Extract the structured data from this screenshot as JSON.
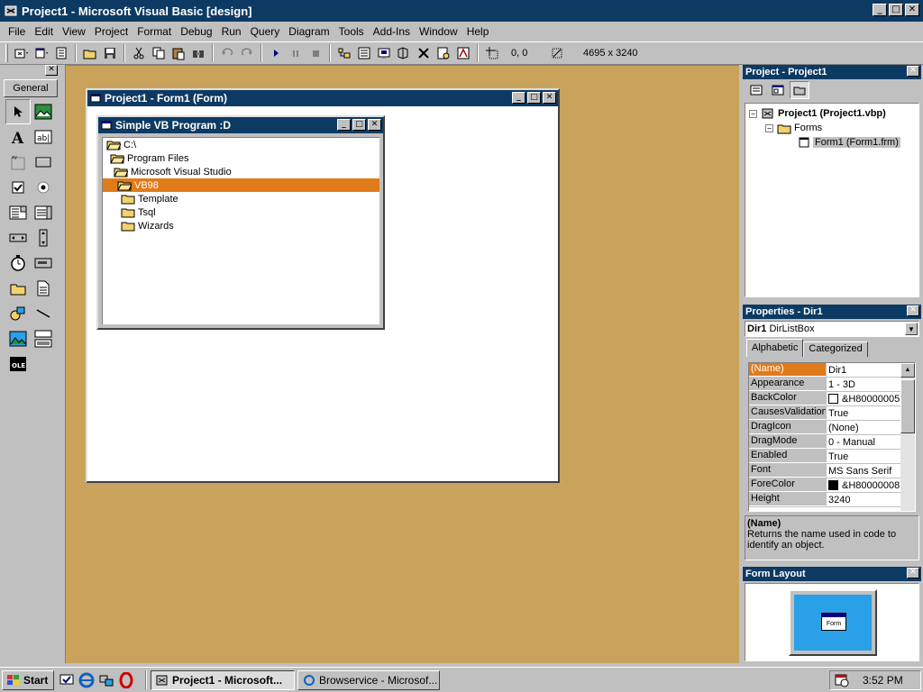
{
  "window": {
    "title": "Project1 - Microsoft Visual Basic [design]",
    "min": "_",
    "max": "□",
    "close": "✕"
  },
  "menu": [
    "File",
    "Edit",
    "View",
    "Project",
    "Format",
    "Debug",
    "Run",
    "Query",
    "Diagram",
    "Tools",
    "Add-Ins",
    "Window",
    "Help"
  ],
  "toolbar": {
    "position": "0, 0",
    "size": "4695 x 3240"
  },
  "toolbox": {
    "tab": "General",
    "close": "✕"
  },
  "form_window": {
    "title": "Project1 - Form1 (Form)"
  },
  "app_window": {
    "title": "Simple VB Program :D"
  },
  "dirlist": {
    "items": [
      {
        "label": "C:\\",
        "indent": 0,
        "selected": false
      },
      {
        "label": "Program Files",
        "indent": 1,
        "selected": false
      },
      {
        "label": "Microsoft Visual Studio",
        "indent": 2,
        "selected": false
      },
      {
        "label": "VB98",
        "indent": 3,
        "selected": true
      },
      {
        "label": "Template",
        "indent": 4,
        "selected": false
      },
      {
        "label": "Tsql",
        "indent": 4,
        "selected": false
      },
      {
        "label": "Wizards",
        "indent": 4,
        "selected": false
      }
    ]
  },
  "project_panel": {
    "title": "Project - Project1",
    "root": "Project1 (Project1.vbp)",
    "folder": "Forms",
    "form": "Form1 (Form1.frm)"
  },
  "properties": {
    "title": "Properties - Dir1",
    "object_name": "Dir1",
    "object_type": "DirListBox",
    "tabs": [
      "Alphabetic",
      "Categorized"
    ],
    "rows": [
      {
        "name": "(Name)",
        "value": "Dir1",
        "selected": true
      },
      {
        "name": "Appearance",
        "value": "1 - 3D"
      },
      {
        "name": "BackColor",
        "value": "&H80000005",
        "swatch": "#ffffff"
      },
      {
        "name": "CausesValidation",
        "value": "True"
      },
      {
        "name": "DragIcon",
        "value": "(None)"
      },
      {
        "name": "DragMode",
        "value": "0 - Manual"
      },
      {
        "name": "Enabled",
        "value": "True"
      },
      {
        "name": "Font",
        "value": "MS Sans Serif"
      },
      {
        "name": "ForeColor",
        "value": "&H80000008",
        "swatch": "#000000"
      },
      {
        "name": "Height",
        "value": "3240"
      }
    ],
    "desc_title": "(Name)",
    "desc_text": "Returns the name used in code to identify an object."
  },
  "layout_panel": {
    "title": "Form Layout",
    "mini_label": "Form"
  },
  "taskbar": {
    "start": "Start",
    "tasks": [
      "Project1 - Microsoft...",
      "Browservice - Microsof..."
    ],
    "clock": "3:52 PM"
  },
  "colors": {
    "title_bg": "#0d3a63",
    "selection": "#e07b1a",
    "designer_bg": "#c9a35c"
  }
}
